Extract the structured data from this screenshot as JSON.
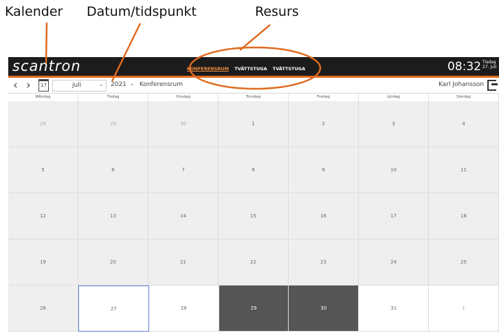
{
  "annotations": {
    "calendar": "Kalender",
    "datetime": "Datum/tidspunkt",
    "resource": "Resurs"
  },
  "header": {
    "logo": "scantron",
    "resources": [
      "KONFERENSRUM",
      "TVÄTTSTUGA",
      "TVÄTTSTUGA"
    ],
    "active_resource_index": 0,
    "time": "08:32",
    "weekday": "Tisdag",
    "date": "27. Juli"
  },
  "toolbar": {
    "prev_icon": "chevron-left-icon",
    "next_icon": "chevron-right-icon",
    "calendar_icon_text": "17",
    "month": "juli",
    "year": "2021",
    "resource": "Konferensrum",
    "user": "Karl Johansson"
  },
  "calendar": {
    "weekdays": [
      "Måndag",
      "Tisdag",
      "Onsdag",
      "Torsdag",
      "Fredag",
      "Lördag",
      "Söndag"
    ],
    "weeks": [
      [
        {
          "d": "28",
          "s": "other"
        },
        {
          "d": "29",
          "s": "other"
        },
        {
          "d": "30",
          "s": "other"
        },
        {
          "d": "1",
          "s": "past"
        },
        {
          "d": "2",
          "s": "past"
        },
        {
          "d": "3",
          "s": "past"
        },
        {
          "d": "4",
          "s": "past"
        }
      ],
      [
        {
          "d": "5",
          "s": "past"
        },
        {
          "d": "6",
          "s": "past"
        },
        {
          "d": "7",
          "s": "past"
        },
        {
          "d": "8",
          "s": "past"
        },
        {
          "d": "9",
          "s": "past"
        },
        {
          "d": "10",
          "s": "past"
        },
        {
          "d": "11",
          "s": "past"
        }
      ],
      [
        {
          "d": "12",
          "s": "past"
        },
        {
          "d": "13",
          "s": "past"
        },
        {
          "d": "14",
          "s": "past"
        },
        {
          "d": "15",
          "s": "past"
        },
        {
          "d": "16",
          "s": "past"
        },
        {
          "d": "17",
          "s": "past"
        },
        {
          "d": "18",
          "s": "past"
        }
      ],
      [
        {
          "d": "19",
          "s": "past"
        },
        {
          "d": "20",
          "s": "past"
        },
        {
          "d": "21",
          "s": "past"
        },
        {
          "d": "22",
          "s": "past"
        },
        {
          "d": "23",
          "s": "past"
        },
        {
          "d": "24",
          "s": "past"
        },
        {
          "d": "25",
          "s": "past"
        }
      ],
      [
        {
          "d": "26",
          "s": "past"
        },
        {
          "d": "27",
          "s": "today"
        },
        {
          "d": "28",
          "s": "avail"
        },
        {
          "d": "29",
          "s": "booked"
        },
        {
          "d": "30",
          "s": "booked"
        },
        {
          "d": "31",
          "s": "avail"
        },
        {
          "d": "1",
          "s": "avail-other"
        }
      ]
    ]
  },
  "colors": {
    "accent": "#e06a1f",
    "topbar": "#1c1c1c",
    "booked": "#555555",
    "today_border": "#5b7fd6",
    "past": "#efefef"
  }
}
